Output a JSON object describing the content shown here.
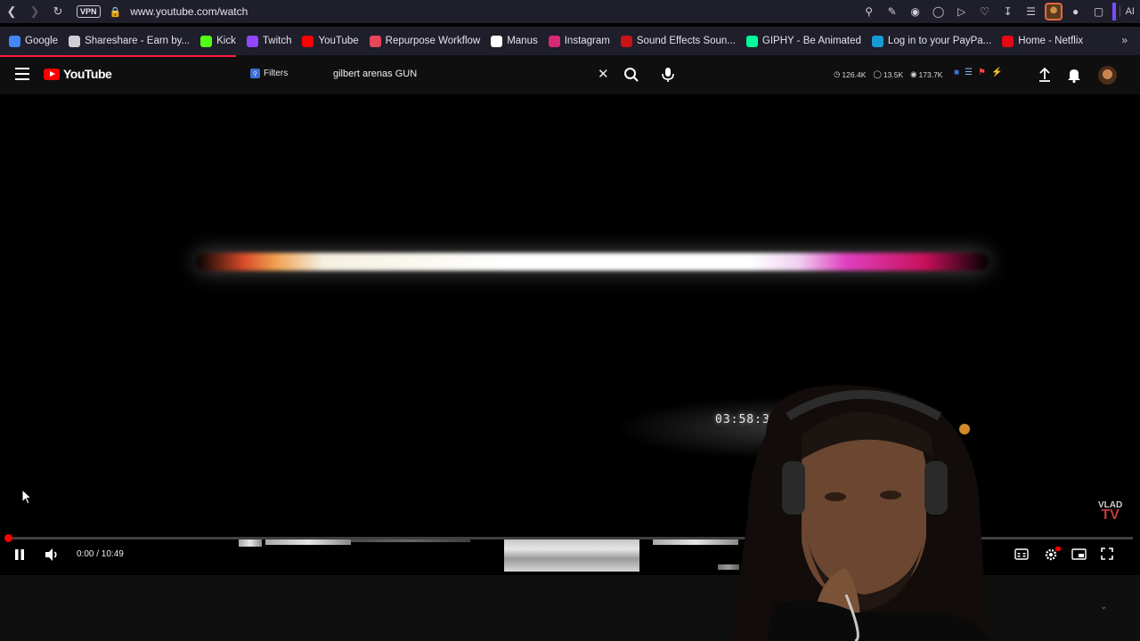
{
  "browser": {
    "url": "www.youtube.com/watch",
    "vpn_label": "VPN",
    "ai_label": "AI"
  },
  "bookmarks": [
    {
      "label": "Google",
      "icon": "google-icon",
      "color": "#4285f4"
    },
    {
      "label": "Shareshare - Earn by...",
      "icon": "page-icon",
      "color": "#cfcfd6"
    },
    {
      "label": "Kick",
      "icon": "kick-icon",
      "color": "#53fc18"
    },
    {
      "label": "Twitch",
      "icon": "twitch-icon",
      "color": "#9146ff"
    },
    {
      "label": "YouTube",
      "icon": "youtube-icon",
      "color": "#ff0000"
    },
    {
      "label": "Repurpose Workflow",
      "icon": "repurpose-icon",
      "color": "#e8455a"
    },
    {
      "label": "Manus",
      "icon": "manus-icon",
      "color": "#ffffff"
    },
    {
      "label": "Instagram",
      "icon": "instagram-icon",
      "color": "#d62976"
    },
    {
      "label": "Sound Effects Soun...",
      "icon": "sound-icon",
      "color": "#c81414"
    },
    {
      "label": "GIPHY - Be Animated",
      "icon": "giphy-icon",
      "color": "#00ff99"
    },
    {
      "label": "Log in to your PayPa...",
      "icon": "paypal-icon",
      "color": "#179bd7"
    },
    {
      "label": "Home - Netflix",
      "icon": "netflix-icon",
      "color": "#e50914"
    }
  ],
  "youtube": {
    "logo_text": "YouTube",
    "filters_label": "Filters",
    "search_value": "gilbert arenas GUN",
    "stats": [
      "126.4K",
      "13.5K",
      "173.7K"
    ]
  },
  "video": {
    "timecode": "03:58:33:13",
    "watermark_top": "VLAD",
    "watermark_bottom": "TV",
    "time_display": "0:00 / 10:49",
    "progress_fraction": 0.0
  },
  "colors": {
    "accent": "#ff0000",
    "browser_bg": "#1f1e2b",
    "yt_bg": "#0f0f0f"
  }
}
